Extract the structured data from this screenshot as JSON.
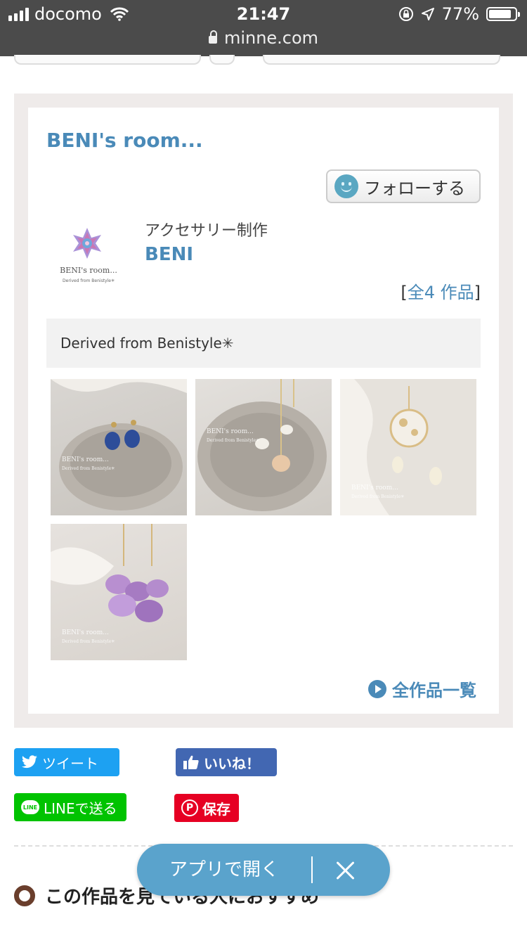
{
  "status_bar": {
    "carrier": "docomo",
    "time": "21:47",
    "battery": "77%",
    "battery_level": 0.77,
    "url": "minne.com"
  },
  "shop": {
    "title": "BENI's room...",
    "follow_label": "フォローする",
    "logo_text": "BENI's room...",
    "logo_subtext": "Derived from Benistyle✳",
    "category": "アクセサリー制作",
    "name": "BENI",
    "works_count_prefix": "[",
    "works_count": "全4 作品",
    "works_count_suffix": "]",
    "description": "Derived from Benistyle✳",
    "thumb_watermark": "BENI's room...",
    "thumb_watermark_sub": "Derived from Benistyle✳",
    "all_works_label": "全作品一覧"
  },
  "share": {
    "tweet": "ツイート",
    "like": "いいね！",
    "line": "LINEで送る",
    "line_icon": "LINE",
    "save": "保存"
  },
  "recommend_heading": "この作品を見ている人におすすめ",
  "app_banner": {
    "open_label": "アプリで開く"
  }
}
